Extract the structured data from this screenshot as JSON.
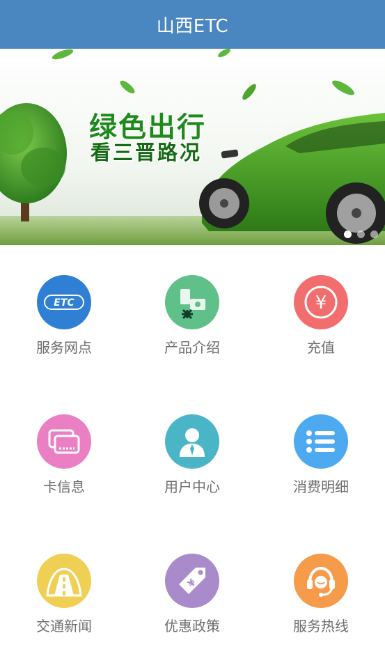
{
  "header": {
    "title": "山西ETC"
  },
  "banner": {
    "slogan_line1": "绿色出行",
    "slogan_line2": "看三晋路况",
    "slide_count": 3,
    "active_slide": 1
  },
  "services": [
    {
      "label": "服务网点",
      "icon": "etc-logo-icon",
      "color": "#2f7fd4"
    },
    {
      "label": "产品介绍",
      "icon": "etc-device-icon",
      "color": "#5fc08a"
    },
    {
      "label": "充值",
      "icon": "yuan-coin-icon",
      "color": "#f26d6d"
    },
    {
      "label": "卡信息",
      "icon": "cards-icon",
      "color": "#ea7fc4"
    },
    {
      "label": "用户中心",
      "icon": "user-icon",
      "color": "#4ab5c6"
    },
    {
      "label": "消费明细",
      "icon": "list-icon",
      "color": "#4da9f0"
    },
    {
      "label": "交通新闻",
      "icon": "road-icon",
      "color": "#f0cf55"
    },
    {
      "label": "优惠政策",
      "icon": "price-tag-icon",
      "color": "#a98bcb"
    },
    {
      "label": "服务热线",
      "icon": "headset-icon",
      "color": "#f59b4a"
    }
  ]
}
